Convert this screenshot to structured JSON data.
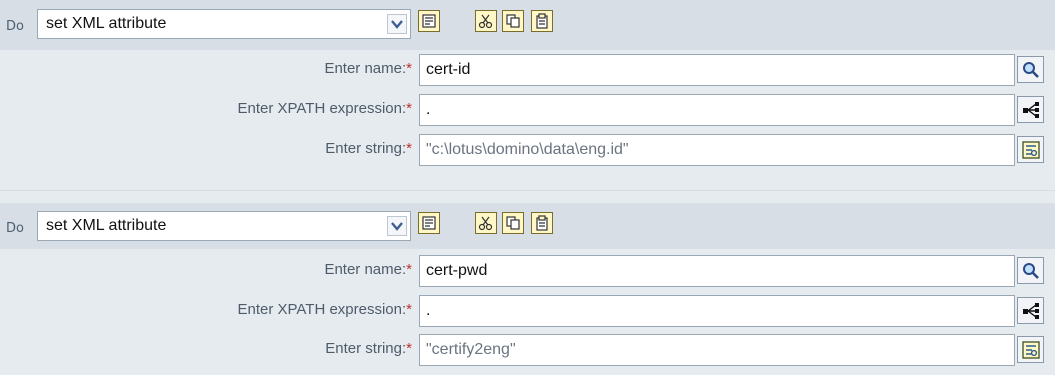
{
  "actions": [
    {
      "do_label": "Do",
      "action_select": {
        "value": "set XML attribute"
      },
      "fields": [
        {
          "label": "Enter name:",
          "required_mark": "*",
          "value": "cert-id",
          "button_icon": "search-icon"
        },
        {
          "label": "Enter XPATH expression:",
          "required_mark": "*",
          "value": ".",
          "button_icon": "xpath-builder-icon"
        },
        {
          "label": "Enter string:",
          "required_mark": "*",
          "value": "\"c:\\lotus\\domino\\data\\eng.id\"",
          "button_icon": "argument-builder-icon"
        }
      ]
    },
    {
      "do_label": "Do",
      "action_select": {
        "value": "set XML attribute"
      },
      "fields": [
        {
          "label": "Enter name:",
          "required_mark": "*",
          "value": "cert-pwd",
          "button_icon": "search-icon"
        },
        {
          "label": "Enter XPATH expression:",
          "required_mark": "*",
          "value": ".",
          "button_icon": "xpath-builder-icon"
        },
        {
          "label": "Enter string:",
          "required_mark": "*",
          "value": "\"certify2eng\"",
          "button_icon": "argument-builder-icon"
        }
      ]
    }
  ],
  "toolbar_icons": [
    "note-icon",
    "cut-icon",
    "copy-icon",
    "paste-icon"
  ],
  "colors": {
    "panel_bg": "#e6ebf0",
    "header_bg": "#d7dee6",
    "required": "#c0312b",
    "label": "#4e5c6a"
  }
}
